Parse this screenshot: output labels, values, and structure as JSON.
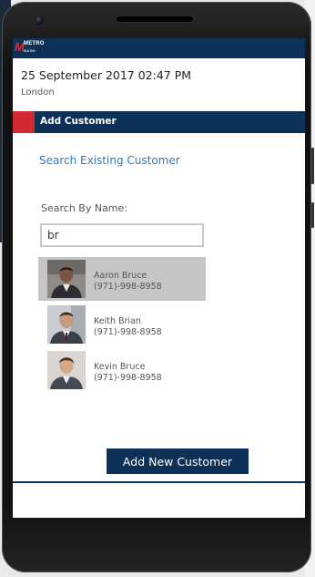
{
  "app": {
    "logo_text": "METRO",
    "logo_sub": "BANK"
  },
  "header": {
    "datetime": "25 September 2017 02:47 PM",
    "location": "London"
  },
  "section": {
    "title": "Add Customer"
  },
  "search": {
    "link_label": "Search Existing Customer",
    "by_name_label": "Search By Name:",
    "query": "br"
  },
  "results": [
    {
      "name": "Aaron Bruce",
      "phone": "(971)-998-8958",
      "selected": true
    },
    {
      "name": "Keith Brian",
      "phone": "(971)-998-8958",
      "selected": false
    },
    {
      "name": "Kevin Bruce",
      "phone": "(971)-998-8958",
      "selected": false
    }
  ],
  "actions": {
    "add_new_label": "Add New Customer"
  },
  "colors": {
    "navy": "#0e3157",
    "accent_red": "#d12a33",
    "link_blue": "#2c7cc0",
    "selected_row": "#c6c6c6"
  },
  "icons": [
    "phone-camera-icon",
    "phone-speaker-icon",
    "avatar-photo"
  ]
}
